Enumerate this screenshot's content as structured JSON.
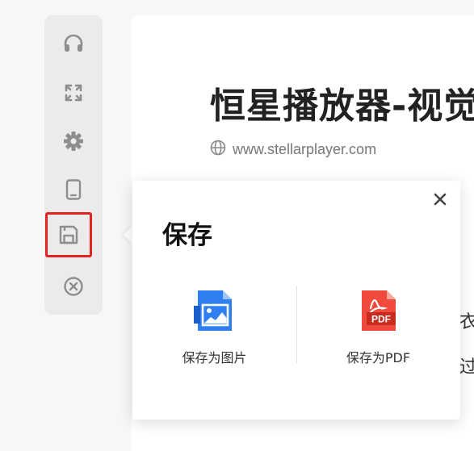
{
  "article": {
    "title": "恒星播放器-视觉革",
    "url": "www.stellarplayer.com",
    "body_char_1": "衣",
    "body_char_2": "过"
  },
  "toolbar": {
    "items": [
      {
        "icon": "headphones-icon"
      },
      {
        "icon": "expand-icon"
      },
      {
        "icon": "gear-icon"
      },
      {
        "icon": "phone-icon"
      },
      {
        "icon": "save-icon",
        "highlighted": true
      },
      {
        "icon": "close-circle-icon"
      }
    ],
    "icon_color": "#8e8e8e",
    "highlight_color": "#e52222"
  },
  "save_popup": {
    "title": "保存",
    "options": [
      {
        "label": "保存为图片",
        "icon": "image-file-icon",
        "color": "#2f7ff2"
      },
      {
        "label": "保存为PDF",
        "icon": "pdf-file-icon",
        "color": "#ef4a3c"
      }
    ]
  }
}
